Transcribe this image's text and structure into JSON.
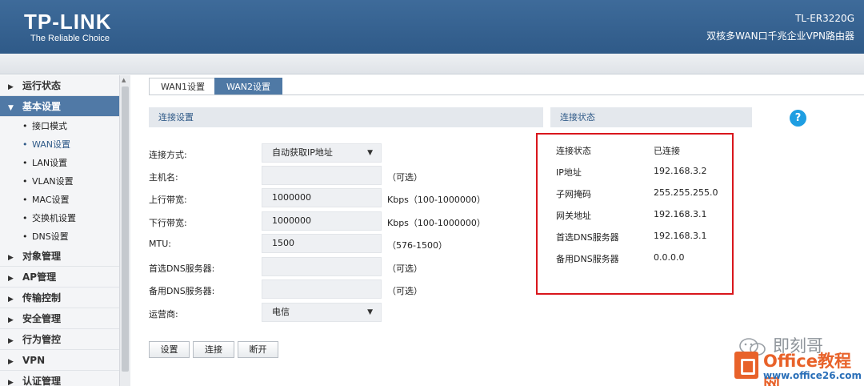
{
  "header": {
    "logo": "TP-LINK",
    "tagline": "The Reliable Choice",
    "model": "TL-ER3220G",
    "product": "双核多WAN口千兆企业VPN路由器"
  },
  "sidebar": {
    "groups": [
      {
        "label": "运行状态",
        "expanded": false
      },
      {
        "label": "基本设置",
        "expanded": true,
        "items": [
          "接口模式",
          "WAN设置",
          "LAN设置",
          "VLAN设置",
          "MAC设置",
          "交换机设置",
          "DNS设置"
        ]
      },
      {
        "label": "对象管理",
        "expanded": false
      },
      {
        "label": "AP管理",
        "expanded": false
      },
      {
        "label": "传输控制",
        "expanded": false
      },
      {
        "label": "安全管理",
        "expanded": false
      },
      {
        "label": "行为管控",
        "expanded": false
      },
      {
        "label": "VPN",
        "expanded": false
      },
      {
        "label": "认证管理",
        "expanded": false
      }
    ],
    "current_item": "WAN设置"
  },
  "tabs": [
    "WAN1设置",
    "WAN2设置"
  ],
  "active_tab": "WAN2设置",
  "connection_settings": {
    "section_title": "连接设置",
    "fields": [
      {
        "label": "连接方式:",
        "value": "自动获取IP地址",
        "type": "select"
      },
      {
        "label": "主机名:",
        "value": "",
        "hint": "（可选）"
      },
      {
        "label": "上行带宽:",
        "value": "1000000",
        "hint": "Kbps（100-1000000）"
      },
      {
        "label": "下行带宽:",
        "value": "1000000",
        "hint": "Kbps（100-1000000）"
      },
      {
        "label": "MTU:",
        "value": "1500",
        "hint": "（576-1500）"
      },
      {
        "label": "首选DNS服务器:",
        "value": "",
        "hint": "（可选）"
      },
      {
        "label": "备用DNS服务器:",
        "value": "",
        "hint": "（可选）"
      },
      {
        "label": "运营商:",
        "value": "电信",
        "type": "select"
      }
    ],
    "buttons": [
      "设置",
      "连接",
      "断开"
    ]
  },
  "connection_status": {
    "section_title": "连接状态",
    "rows": [
      {
        "label": "连接状态",
        "value": "已连接"
      },
      {
        "label": "IP地址",
        "value": "192.168.3.2"
      },
      {
        "label": "子网掩码",
        "value": "255.255.255.0"
      },
      {
        "label": "网关地址",
        "value": "192.168.3.1"
      },
      {
        "label": "首选DNS服务器",
        "value": "192.168.3.1"
      },
      {
        "label": "备用DNS服务器",
        "value": "0.0.0.0"
      }
    ]
  },
  "help_label": "?",
  "watermark": {
    "wechat_name": "即刻哥",
    "brand_name": "Office教程网",
    "brand_url": "www.office26.com"
  },
  "colors": {
    "header_blue": "#3e6b9a",
    "active_tab": "#4f79a5",
    "highlight_border": "#d9161c",
    "help_icon": "#1e9ee2",
    "brand_orange": "#e8622a"
  }
}
